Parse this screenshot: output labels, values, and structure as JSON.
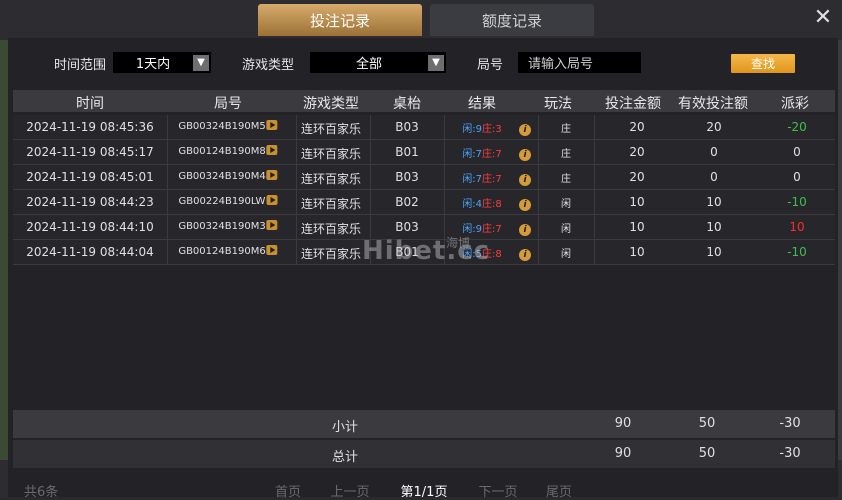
{
  "tabs": [
    {
      "label": "投注记录",
      "active": true
    },
    {
      "label": "额度记录",
      "active": false
    }
  ],
  "close_symbol": "✕",
  "filters": {
    "time_label": "时间范围",
    "time_value": "1天内",
    "game_type_label": "游戏类型",
    "game_type_value": "全部",
    "round_label": "局号",
    "round_placeholder": "请输入局号",
    "search_button": "查找"
  },
  "columns": [
    "时间",
    "局号",
    "游戏类型",
    "桌枱",
    "结果",
    "玩法",
    "投注金额",
    "有效投注额",
    "派彩"
  ],
  "rows": [
    {
      "time": "2024-11-19 08:45:36",
      "round": "GB00324B190M5",
      "game": "连环百家乐",
      "table": "B03",
      "result_x": "闲:9",
      "result_z": "庄:3",
      "play": "庄",
      "bet": "20",
      "valid": "20",
      "payout": "-20",
      "payout_color": "green"
    },
    {
      "time": "2024-11-19 08:45:17",
      "round": "GB00124B190M8",
      "game": "连环百家乐",
      "table": "B01",
      "result_x": "闲:7",
      "result_z": "庄:7",
      "play": "庄",
      "bet": "20",
      "valid": "0",
      "payout": "0",
      "payout_color": "white"
    },
    {
      "time": "2024-11-19 08:45:01",
      "round": "GB00324B190M4",
      "game": "连环百家乐",
      "table": "B03",
      "result_x": "闲:7",
      "result_z": "庄:7",
      "play": "庄",
      "bet": "20",
      "valid": "0",
      "payout": "0",
      "payout_color": "white"
    },
    {
      "time": "2024-11-19 08:44:23",
      "round": "GB00224B190LW",
      "game": "连环百家乐",
      "table": "B02",
      "result_x": "闲:4",
      "result_z": "庄:8",
      "play": "闲",
      "bet": "10",
      "valid": "10",
      "payout": "-10",
      "payout_color": "green"
    },
    {
      "time": "2024-11-19 08:44:10",
      "round": "GB00324B190M3",
      "game": "连环百家乐",
      "table": "B03",
      "result_x": "闲:9",
      "result_z": "庄:7",
      "play": "闲",
      "bet": "10",
      "valid": "10",
      "payout": "10",
      "payout_color": "red"
    },
    {
      "time": "2024-11-19 08:44:04",
      "round": "GB00124B190M6",
      "game": "连环百家乐",
      "table": "B01",
      "result_x": "闲:5",
      "result_z": "庄:8",
      "play": "闲",
      "bet": "10",
      "valid": "10",
      "payout": "-10",
      "payout_color": "green"
    }
  ],
  "subtotal": {
    "label": "小计",
    "bet": "90",
    "valid": "50",
    "payout": "-30"
  },
  "total": {
    "label": "总计",
    "bet": "90",
    "valid": "50",
    "payout": "-30"
  },
  "pagination": {
    "count": "共6条",
    "first": "首页",
    "prev": "上一页",
    "current": "第1/1页",
    "next": "下一页",
    "last": "尾页"
  },
  "watermark": {
    "text": "Hibet.cc",
    "sub": "海博"
  },
  "colors": {
    "accent": "#d7ab6c",
    "button": "#f0a830",
    "loss": "#3fbe4c",
    "win": "#ff2a2a",
    "player": "#4aa3ff",
    "banker": "#ff3b3b"
  }
}
